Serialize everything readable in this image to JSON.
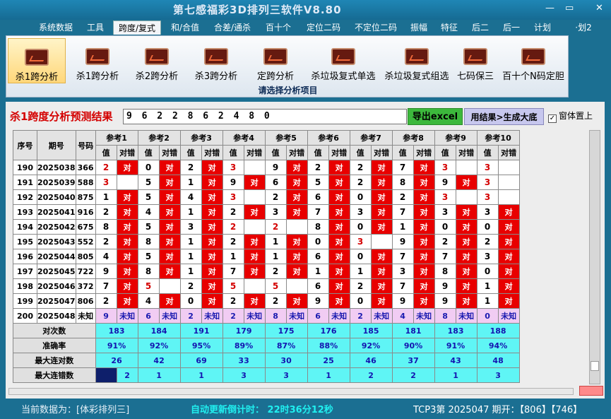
{
  "window": {
    "title": "第七感福彩3D排列三软件V8.80",
    "ctrl_min": "—",
    "ctrl_max": "▭",
    "ctrl_close": "✕"
  },
  "menu": [
    "系统数据",
    "工具",
    "跨度/复式",
    "和/合值",
    "合差/通杀",
    "百十个",
    "定位二码",
    "不定位二码",
    "振幅",
    "特征",
    "后二",
    "后一",
    "计划",
    "·划2"
  ],
  "active_menu": "跨度/复式",
  "ribbon": {
    "buttons": [
      "杀1跨分析",
      "杀1跨分析",
      "杀2跨分析",
      "杀3跨分析",
      "定跨分析",
      "杀垃圾复式单选",
      "杀垃圾复式组选",
      "七码保三",
      "百十个N码定胆"
    ],
    "caption": "请选择分析项目"
  },
  "result": {
    "label": "杀1跨度分析预测结果",
    "value": "9 6 2 2 8 6 2 4 8 0",
    "export_button": "导出excel",
    "generate_button": "用结果>生成大底",
    "pin_label": "窗体置上",
    "pin_checked": true
  },
  "table": {
    "header": {
      "seq": "序号",
      "period": "期号",
      "number": "号码",
      "val": "值",
      "flag": "对错"
    },
    "refs": [
      "参考1",
      "参考2",
      "参考3",
      "参考4",
      "参考5",
      "参考6",
      "参考7",
      "参考8",
      "参考9",
      "参考10"
    ],
    "rows": [
      {
        "seq": "190",
        "period": "2025038",
        "num": "366",
        "cells": [
          [
            2,
            "对"
          ],
          [
            0,
            "对"
          ],
          [
            2,
            "对"
          ],
          [
            3,
            ""
          ],
          [
            9,
            "对"
          ],
          [
            2,
            "对"
          ],
          [
            2,
            "对"
          ],
          [
            7,
            "对"
          ],
          [
            3,
            ""
          ],
          [
            3,
            ""
          ]
        ]
      },
      {
        "seq": "191",
        "period": "2025039",
        "num": "588",
        "cells": [
          [
            3,
            ""
          ],
          [
            5,
            "对"
          ],
          [
            1,
            "对"
          ],
          [
            9,
            "对"
          ],
          [
            6,
            "对"
          ],
          [
            5,
            "对"
          ],
          [
            2,
            "对"
          ],
          [
            8,
            "对"
          ],
          [
            9,
            "对"
          ],
          [
            3,
            ""
          ]
        ]
      },
      {
        "seq": "192",
        "period": "2025040",
        "num": "875",
        "cells": [
          [
            1,
            "对"
          ],
          [
            5,
            "对"
          ],
          [
            4,
            "对"
          ],
          [
            3,
            ""
          ],
          [
            2,
            "对"
          ],
          [
            6,
            "对"
          ],
          [
            0,
            "对"
          ],
          [
            2,
            "对"
          ],
          [
            3,
            ""
          ],
          [
            3,
            ""
          ]
        ]
      },
      {
        "seq": "193",
        "period": "2025041",
        "num": "916",
        "cells": [
          [
            2,
            "对"
          ],
          [
            4,
            "对"
          ],
          [
            1,
            "对"
          ],
          [
            2,
            "对"
          ],
          [
            3,
            "对"
          ],
          [
            7,
            "对"
          ],
          [
            3,
            "对"
          ],
          [
            7,
            "对"
          ],
          [
            3,
            "对"
          ],
          [
            3,
            "对"
          ]
        ]
      },
      {
        "seq": "194",
        "period": "2025042",
        "num": "675",
        "cells": [
          [
            8,
            "对"
          ],
          [
            5,
            "对"
          ],
          [
            3,
            "对"
          ],
          [
            2,
            ""
          ],
          [
            2,
            ""
          ],
          [
            8,
            "对"
          ],
          [
            0,
            "对"
          ],
          [
            1,
            "对"
          ],
          [
            0,
            "对"
          ],
          [
            0,
            "对"
          ]
        ]
      },
      {
        "seq": "195",
        "period": "2025043",
        "num": "552",
        "cells": [
          [
            2,
            "对"
          ],
          [
            8,
            "对"
          ],
          [
            1,
            "对"
          ],
          [
            2,
            "对"
          ],
          [
            1,
            "对"
          ],
          [
            0,
            "对"
          ],
          [
            3,
            ""
          ],
          [
            9,
            "对"
          ],
          [
            2,
            "对"
          ],
          [
            2,
            "对"
          ]
        ]
      },
      {
        "seq": "196",
        "period": "2025044",
        "num": "805",
        "cells": [
          [
            4,
            "对"
          ],
          [
            5,
            "对"
          ],
          [
            1,
            "对"
          ],
          [
            1,
            "对"
          ],
          [
            1,
            "对"
          ],
          [
            6,
            "对"
          ],
          [
            0,
            "对"
          ],
          [
            7,
            "对"
          ],
          [
            7,
            "对"
          ],
          [
            3,
            "对"
          ]
        ]
      },
      {
        "seq": "197",
        "period": "2025045",
        "num": "722",
        "cells": [
          [
            9,
            "对"
          ],
          [
            8,
            "对"
          ],
          [
            1,
            "对"
          ],
          [
            7,
            "对"
          ],
          [
            2,
            "对"
          ],
          [
            1,
            "对"
          ],
          [
            1,
            "对"
          ],
          [
            3,
            "对"
          ],
          [
            8,
            "对"
          ],
          [
            0,
            "对"
          ]
        ]
      },
      {
        "seq": "198",
        "period": "2025046",
        "num": "372",
        "cells": [
          [
            7,
            "对"
          ],
          [
            5,
            ""
          ],
          [
            2,
            "对"
          ],
          [
            5,
            ""
          ],
          [
            5,
            ""
          ],
          [
            6,
            "对"
          ],
          [
            2,
            "对"
          ],
          [
            7,
            "对"
          ],
          [
            9,
            "对"
          ],
          [
            1,
            "对"
          ]
        ]
      },
      {
        "seq": "199",
        "period": "2025047",
        "num": "806",
        "cells": [
          [
            2,
            "对"
          ],
          [
            4,
            "对"
          ],
          [
            0,
            "对"
          ],
          [
            2,
            "对"
          ],
          [
            2,
            "对"
          ],
          [
            9,
            "对"
          ],
          [
            0,
            "对"
          ],
          [
            9,
            "对"
          ],
          [
            9,
            "对"
          ],
          [
            1,
            "对"
          ]
        ]
      }
    ],
    "red_values": [
      [
        0,
        0
      ],
      [
        0,
        3
      ],
      [
        0,
        8
      ],
      [
        0,
        9
      ],
      [
        1,
        0
      ],
      [
        1,
        9
      ],
      [
        2,
        3
      ],
      [
        2,
        8
      ],
      [
        2,
        9
      ],
      [
        4,
        3
      ],
      [
        4,
        4
      ],
      [
        5,
        6
      ],
      [
        8,
        1
      ],
      [
        8,
        3
      ],
      [
        8,
        4
      ]
    ],
    "pending": {
      "seq": "200",
      "period": "2025048",
      "num": "未知",
      "vals": [
        9,
        6,
        2,
        2,
        8,
        6,
        2,
        4,
        8,
        0
      ],
      "flag": "未知"
    },
    "stats": [
      {
        "label": "对次数",
        "values": [
          "183",
          "184",
          "191",
          "179",
          "175",
          "176",
          "185",
          "181",
          "183",
          "188"
        ]
      },
      {
        "label": "准确率",
        "values": [
          "91%",
          "92%",
          "95%",
          "89%",
          "87%",
          "88%",
          "92%",
          "90%",
          "91%",
          "94%"
        ]
      },
      {
        "label": "最大连对数",
        "values": [
          "26",
          "42",
          "69",
          "33",
          "30",
          "25",
          "46",
          "37",
          "43",
          "48"
        ]
      },
      {
        "label": "最大连错数",
        "values": [
          "2",
          "1",
          "1",
          "3",
          "3",
          "1",
          "2",
          "2",
          "1",
          "3"
        ]
      }
    ]
  },
  "status": {
    "current": "当前数据为：[体彩排列三]",
    "countdown": "自动更新倒计时：  22时36分12秒",
    "issue": "TCP3第 2025047 期开：【806】【746】"
  }
}
